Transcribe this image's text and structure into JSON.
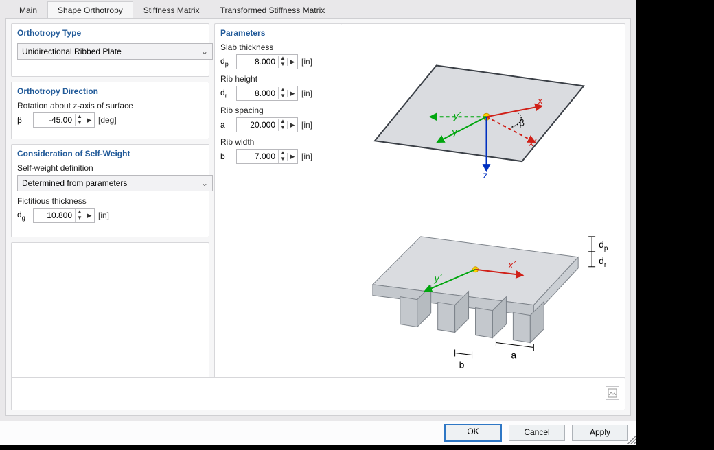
{
  "tabs": [
    "Main",
    "Shape Orthotropy",
    "Stiffness Matrix",
    "Transformed Stiffness Matrix"
  ],
  "active_tab": 1,
  "ortho_type": {
    "title": "Orthotropy Type",
    "value": "Unidirectional Ribbed Plate"
  },
  "direction": {
    "title": "Orthotropy Direction",
    "label": "Rotation about z-axis of surface",
    "symbol": "β",
    "value": "-45.00",
    "unit": "[deg]"
  },
  "self_weight": {
    "title": "Consideration of Self-Weight",
    "def_label": "Self-weight definition",
    "def_value": "Determined from parameters",
    "ft_label": "Fictitious thickness",
    "ft_symbol": "d",
    "ft_sub": "g",
    "ft_value": "10.800",
    "ft_unit": "[in]"
  },
  "params": {
    "title": "Parameters",
    "rows": [
      {
        "label": "Slab thickness",
        "symbol": "d",
        "sub": "p",
        "value": "8.000",
        "unit": "[in]"
      },
      {
        "label": "Rib height",
        "symbol": "d",
        "sub": "r",
        "value": "8.000",
        "unit": "[in]"
      },
      {
        "label": "Rib spacing",
        "symbol": "a",
        "sub": "",
        "value": "20.000",
        "unit": "[in]"
      },
      {
        "label": "Rib width",
        "symbol": "b",
        "sub": "",
        "value": "7.000",
        "unit": "[in]"
      }
    ]
  },
  "preview": {
    "labels": {
      "y": "y",
      "yprime": "y´",
      "x": "x",
      "xprime": "x´",
      "z": "z",
      "beta": "β",
      "dp": "d",
      "dp_sub": "p",
      "dr": "d",
      "dr_sub": "r",
      "a": "a",
      "b": "b"
    }
  },
  "buttons": {
    "ok": "OK",
    "cancel": "Cancel",
    "apply": "Apply"
  }
}
